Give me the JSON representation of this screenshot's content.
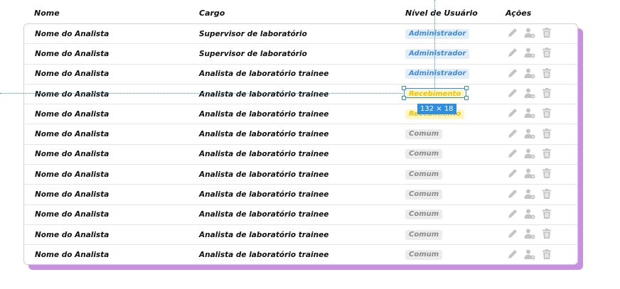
{
  "header": {
    "name": "Nome",
    "role": "Cargo",
    "level": "Nível de Usuário",
    "actions": "Ações"
  },
  "icons": [
    "pencil-icon",
    "user-settings-icon",
    "trash-icon"
  ],
  "colors": {
    "card_shadow": "#c890e0",
    "admin_text": "#3d8be0",
    "admin_bg": "#e3edf8",
    "recebimento_text": "#f2c200",
    "recebimento_bg": "#fff6c8",
    "comum_text": "#8a8a8a",
    "comum_bg": "#ececec",
    "selection": "#2f8ee0",
    "icon_gray": "#c4c4c4"
  },
  "selection_tag": "132 × 18",
  "rows": [
    {
      "name": "Nome do Analista",
      "role": "Supervisor de laboratório",
      "level": "Administrador",
      "type": "admin"
    },
    {
      "name": "Nome do Analista",
      "role": "Supervisor de laboratório",
      "level": "Administrador",
      "type": "admin"
    },
    {
      "name": "Nome do Analista",
      "role": "Analista de laboratório trainee",
      "level": "Administrador",
      "type": "admin"
    },
    {
      "name": "Nome do Analista",
      "role": "Analista de laboratório trainee",
      "level": "Recebimento",
      "type": "receb"
    },
    {
      "name": "Nome do Analista",
      "role": "Analista de laboratório trainee",
      "level": "Recebimento",
      "type": "receb"
    },
    {
      "name": "Nome do Analista",
      "role": "Analista de laboratório trainee",
      "level": "Comum",
      "type": "comum"
    },
    {
      "name": "Nome do Analista",
      "role": "Analista de laboratório trainee",
      "level": "Comum",
      "type": "comum"
    },
    {
      "name": "Nome do Analista",
      "role": "Analista de laboratório trainee",
      "level": "Comum",
      "type": "comum"
    },
    {
      "name": "Nome do Analista",
      "role": "Analista de laboratório trainee",
      "level": "Comum",
      "type": "comum"
    },
    {
      "name": "Nome do Analista",
      "role": "Analista de laboratório trainee",
      "level": "Comum",
      "type": "comum"
    },
    {
      "name": "Nome do Analista",
      "role": "Analista de laboratório trainee",
      "level": "Comum",
      "type": "comum"
    },
    {
      "name": "Nome do Analista",
      "role": "Analista de laboratório trainee",
      "level": "Comum",
      "type": "comum"
    }
  ]
}
